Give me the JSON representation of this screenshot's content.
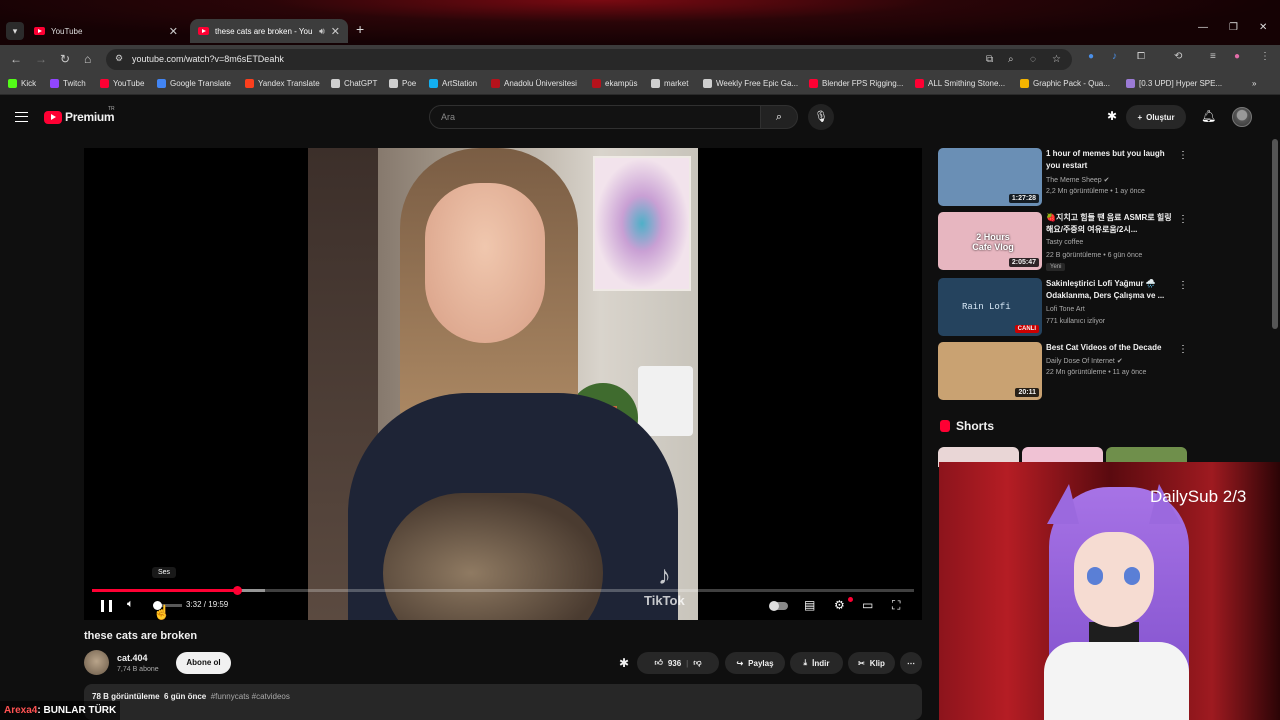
{
  "browser": {
    "tabs": [
      {
        "title": "YouTube"
      },
      {
        "title": "these cats are broken - You"
      }
    ],
    "url": "youtube.com/watch?v=8m6sETDeahk",
    "bookmarks": [
      {
        "label": "Kick",
        "color": "#53fc18"
      },
      {
        "label": "Twitch",
        "color": "#9146ff"
      },
      {
        "label": "YouTube",
        "color": "#ff0033"
      },
      {
        "label": "Google Translate",
        "color": "#4285f4"
      },
      {
        "label": "Yandex Translate",
        "color": "#fc3f1d"
      },
      {
        "label": "ChatGPT",
        "color": "#cfcfcf"
      },
      {
        "label": "Poe",
        "color": "#cfcfcf"
      },
      {
        "label": "ArtStation",
        "color": "#13aff0"
      },
      {
        "label": "Anadolu Üniversitesi",
        "color": "#b5121b"
      },
      {
        "label": "ekampüs",
        "color": "#b5121b"
      },
      {
        "label": "market",
        "color": "#cfcfcf"
      },
      {
        "label": "Weekly Free Epic Ga...",
        "color": "#cfcfcf"
      },
      {
        "label": "Blender FPS Rigging...",
        "color": "#ff0033"
      },
      {
        "label": "ALL Smithing Stone...",
        "color": "#ff0033"
      },
      {
        "label": "Graphic Pack - Qua...",
        "color": "#f4b400"
      },
      {
        "label": "[0.3 UPD] Hyper SPE...",
        "color": "#9b7bd6"
      }
    ]
  },
  "youtube": {
    "logo_text": "Premium",
    "country_code": "TR",
    "search_placeholder": "Ara",
    "create_label": "Oluştur"
  },
  "player": {
    "tooltip": "Ses",
    "time": "3:32 / 19:59",
    "progress_fraction": 0.177,
    "buffer_fraction": 0.21,
    "volume_fraction": 0.1,
    "watermark": "TikTok"
  },
  "video": {
    "title": "these cats are broken",
    "channel": "cat.404",
    "subscribers": "7,74 B abone",
    "subscribe_label": "Abone ol",
    "likes": "936",
    "share_label": "Paylaş",
    "download_label": "İndir",
    "clip_label": "Klip",
    "views": "78 B görüntüleme",
    "age": "6 gün önce",
    "hashtags": "#funnycats #catvideos"
  },
  "recommendations": [
    {
      "title": "1 hour of memes but you laugh you restart",
      "channel": "The Meme Sheep",
      "verified": true,
      "stats": "2,2 Mn görüntüleme • 1 ay önce",
      "duration": "1:27:28",
      "thumb_color": "#6a8fb5"
    },
    {
      "title": "🍓지치고 힘들 땐 음료 ASMR로 힐링해요/주중의 여유로움/2시...",
      "channel": "Tasty coffee",
      "verified": false,
      "stats": "22 B görüntüleme • 6 gün önce",
      "duration": "2:05:47",
      "badge": "Yeni",
      "thumb_color": "#e7b6c0",
      "thumb_text": "2 Hours Cafe Vlog"
    },
    {
      "title": "Sakinleştirici Lofi Yağmur 🌧️ Odaklanma, Ders Çalışma ve ...",
      "channel": "Lofi Tone Art",
      "verified": false,
      "stats": "771 kullanıcı izliyor",
      "live": "CANLI",
      "thumb_color": "#25435e",
      "thumb_text": "Rain Lofi"
    },
    {
      "title": "Best Cat Videos of the Decade",
      "channel": "Daily Dose Of Internet",
      "verified": true,
      "stats": "22 Mn görüntüleme • 11 ay önce",
      "duration": "20:11",
      "thumb_color": "#c9a272"
    }
  ],
  "shorts": {
    "heading": "Shorts",
    "colors": [
      "#e9d6d6",
      "#f0c2d4",
      "#6f8f4b"
    ]
  },
  "overlay": {
    "stream_label": "DailySub 2/3",
    "chat_user": "Arexa4",
    "chat_message": ": BUNLAR TÜRK"
  }
}
